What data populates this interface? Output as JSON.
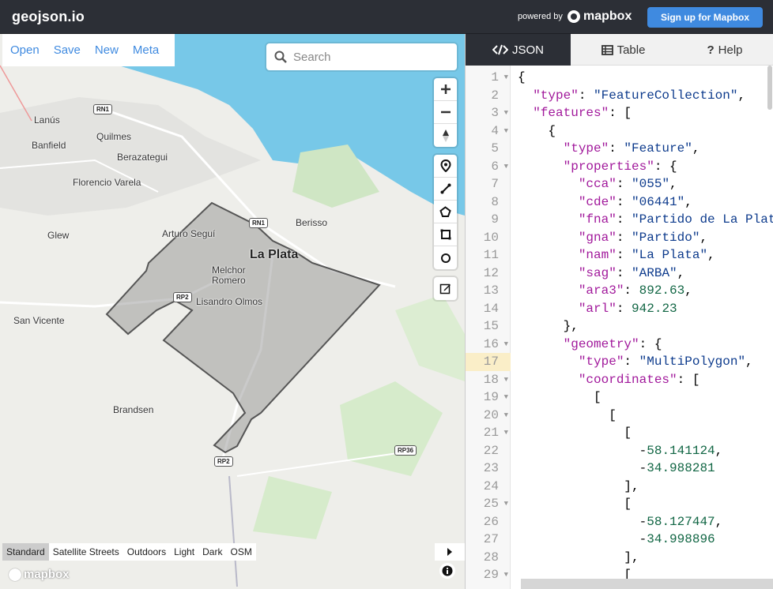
{
  "app": {
    "brand": "geojson.io",
    "powered_by": "powered by",
    "mapbox_logo": "mapbox",
    "signup_label": "Sign up for Mapbox"
  },
  "menu": {
    "items": [
      {
        "label": "Open"
      },
      {
        "label": "Save"
      },
      {
        "label": "New"
      },
      {
        "label": "Meta"
      }
    ]
  },
  "search": {
    "placeholder": "Search"
  },
  "map": {
    "labels": {
      "lanus": "Lanús",
      "quilmes": "Quilmes",
      "banfield": "Banfield",
      "berazategui": "Berazategui",
      "florencio_varela": "Florencio Varela",
      "glew": "Glew",
      "arturo_segui": "Arturo Seguí",
      "berisso": "Berisso",
      "la_plata": "La Plata",
      "melchor_romero_1": "Melchor",
      "melchor_romero_2": "Romero",
      "lisandro_olmos": "Lisandro Olmos",
      "san_vicente": "San Vicente",
      "brandsen": "Brandsen"
    },
    "shields": {
      "rn1_a": "RN1",
      "rn1_b": "RN1",
      "rp2_a": "RP2",
      "rp2_b": "RP2",
      "rp36": "RP36"
    },
    "styles": [
      {
        "label": "Standard",
        "active": true
      },
      {
        "label": "Satellite Streets",
        "active": false
      },
      {
        "label": "Outdoors",
        "active": false
      },
      {
        "label": "Light",
        "active": false
      },
      {
        "label": "Dark",
        "active": false
      },
      {
        "label": "OSM",
        "active": false
      }
    ],
    "wordmark": "mapbox"
  },
  "tabs": [
    {
      "label": "JSON",
      "icon": "code-icon",
      "active": true
    },
    {
      "label": "Table",
      "icon": "table-icon",
      "active": false
    },
    {
      "label": "Help",
      "icon": "question-icon",
      "active": false
    }
  ],
  "editor": {
    "current_line": 17,
    "lines": [
      {
        "n": "1",
        "fold": true,
        "html": "<span class='p'>{</span>"
      },
      {
        "n": "2",
        "fold": false,
        "html": "  <span class='k'>\"type\"</span>: <span class='s'>\"FeatureCollection\"</span>,"
      },
      {
        "n": "3",
        "fold": true,
        "html": "  <span class='k'>\"features\"</span>: ["
      },
      {
        "n": "4",
        "fold": true,
        "html": "    {"
      },
      {
        "n": "5",
        "fold": false,
        "html": "      <span class='k'>\"type\"</span>: <span class='s'>\"Feature\"</span>,"
      },
      {
        "n": "6",
        "fold": true,
        "html": "      <span class='k'>\"properties\"</span>: {"
      },
      {
        "n": "7",
        "fold": false,
        "html": "        <span class='k'>\"cca\"</span>: <span class='s'>\"055\"</span>,"
      },
      {
        "n": "8",
        "fold": false,
        "html": "        <span class='k'>\"cde\"</span>: <span class='s'>\"06441\"</span>,"
      },
      {
        "n": "9",
        "fold": false,
        "html": "        <span class='k'>\"fna\"</span>: <span class='s'>\"Partido de La Plata\"</span>,"
      },
      {
        "n": "10",
        "fold": false,
        "html": "        <span class='k'>\"gna\"</span>: <span class='s'>\"Partido\"</span>,"
      },
      {
        "n": "11",
        "fold": false,
        "html": "        <span class='k'>\"nam\"</span>: <span class='s'>\"La Plata\"</span>,"
      },
      {
        "n": "12",
        "fold": false,
        "html": "        <span class='k'>\"sag\"</span>: <span class='s'>\"ARBA\"</span>,"
      },
      {
        "n": "13",
        "fold": false,
        "html": "        <span class='k'>\"ara3\"</span>: <span class='n'>892.63</span>,"
      },
      {
        "n": "14",
        "fold": false,
        "html": "        <span class='k'>\"arl\"</span>: <span class='n'>942.23</span>"
      },
      {
        "n": "15",
        "fold": false,
        "html": "      },"
      },
      {
        "n": "16",
        "fold": true,
        "html": "      <span class='k'>\"geometry\"</span>: {"
      },
      {
        "n": "17",
        "fold": false,
        "html": "        <span class='k'>\"type\"</span>: <span class='s'>\"MultiPolygon\"</span>,"
      },
      {
        "n": "18",
        "fold": true,
        "html": "        <span class='k'>\"coordinates\"</span>: ["
      },
      {
        "n": "19",
        "fold": true,
        "html": "          ["
      },
      {
        "n": "20",
        "fold": true,
        "html": "            ["
      },
      {
        "n": "21",
        "fold": true,
        "html": "              ["
      },
      {
        "n": "22",
        "fold": false,
        "html": "                -<span class='n'>58.141124</span>,"
      },
      {
        "n": "23",
        "fold": false,
        "html": "                -<span class='n'>34.988281</span>"
      },
      {
        "n": "24",
        "fold": false,
        "html": "              ],"
      },
      {
        "n": "25",
        "fold": true,
        "html": "              ["
      },
      {
        "n": "26",
        "fold": false,
        "html": "                -<span class='n'>58.127447</span>,"
      },
      {
        "n": "27",
        "fold": false,
        "html": "                -<span class='n'>34.998896</span>"
      },
      {
        "n": "28",
        "fold": false,
        "html": "              ],"
      },
      {
        "n": "29",
        "fold": true,
        "html": "              ["
      }
    ]
  }
}
